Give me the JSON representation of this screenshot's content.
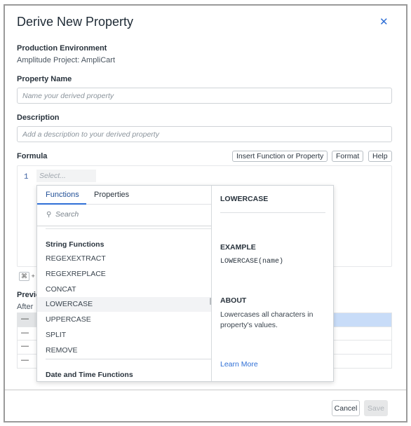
{
  "dialog": {
    "title": "Derive New Property",
    "close_icon": "close-icon"
  },
  "environment": {
    "label": "Production Environment",
    "project": "Amplitude Project: AmpliCart"
  },
  "property_name": {
    "label": "Property Name",
    "placeholder": "Name your derived property",
    "value": ""
  },
  "description": {
    "label": "Description",
    "placeholder": "Add a description to your derived property",
    "value": ""
  },
  "formula": {
    "label": "Formula",
    "buttons": {
      "insert": "Insert Function or Property",
      "format": "Format",
      "help": "Help"
    },
    "line_number": "1",
    "select_placeholder": "Select...",
    "shortcut_key": "⌘",
    "shortcut_plus": "+"
  },
  "popover": {
    "tabs": [
      {
        "label": "Functions",
        "active": true
      },
      {
        "label": "Properties",
        "active": false
      }
    ],
    "search_placeholder": "Search",
    "search_icon": "search-icon",
    "groups": [
      {
        "header": "String Functions",
        "items": [
          "REGEXEXTRACT",
          "REGEXREPLACE",
          "CONCAT",
          "LOWERCASE",
          "UPPERCASE",
          "SPLIT",
          "REMOVE"
        ]
      },
      {
        "header": "Date and Time Functions",
        "items": []
      }
    ],
    "hovered_item": "LOWERCASE",
    "detail": {
      "title": "LOWERCASE",
      "example_header": "EXAMPLE",
      "example_code": "LOWERCASE(name)",
      "about_header": "ABOUT",
      "about_text": "Lowercases all characters in property's values.",
      "learn_more": "Learn More"
    }
  },
  "preview": {
    "label": "Previe",
    "subtext": "After",
    "rows": [
      "—",
      "—",
      "—",
      "—"
    ]
  },
  "footer": {
    "cancel": "Cancel",
    "save": "Save",
    "save_disabled": true
  },
  "colors": {
    "accent": "#2f6fd6",
    "selected_row": "#c8dcf8"
  }
}
